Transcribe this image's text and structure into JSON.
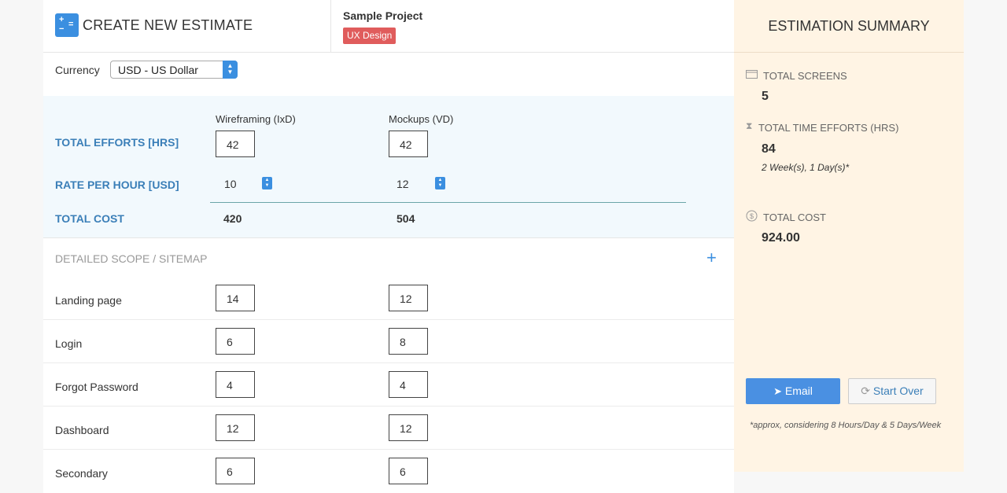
{
  "header": {
    "title": "CREATE NEW ESTIMATE",
    "project_name": "Sample Project",
    "project_tag": "UX Design"
  },
  "currency": {
    "label": "Currency",
    "selected": "USD - US Dollar"
  },
  "efforts": {
    "columns": [
      "Wireframing (IxD)",
      "Mockups (VD)"
    ],
    "total_efforts_label": "TOTAL EFFORTS [HRS]",
    "total_efforts": [
      "42",
      "42"
    ],
    "rate_label": "RATE PER HOUR [USD]",
    "rates": [
      "10",
      "12"
    ],
    "total_cost_label": "TOTAL COST",
    "total_costs": [
      "420",
      "504"
    ]
  },
  "scope": {
    "title": "DETAILED SCOPE / SITEMAP",
    "rows": [
      {
        "name": "Landing page",
        "wireframing": "14",
        "mockups": "12"
      },
      {
        "name": "Login",
        "wireframing": "6",
        "mockups": "8"
      },
      {
        "name": "Forgot Password",
        "wireframing": "4",
        "mockups": "4"
      },
      {
        "name": "Dashboard",
        "wireframing": "12",
        "mockups": "12"
      },
      {
        "name": "Secondary",
        "wireframing": "6",
        "mockups": "6"
      }
    ]
  },
  "summary": {
    "title": "ESTIMATION SUMMARY",
    "total_screens_label": "TOTAL SCREENS",
    "total_screens": "5",
    "total_time_label": "TOTAL TIME EFFORTS (HRS)",
    "total_time": "84",
    "time_note": "2 Week(s), 1 Day(s)*",
    "total_cost_label": "TOTAL COST",
    "total_cost": "924.00",
    "email_button": "Email",
    "start_over_button": "Start Over",
    "footnote": "*approx, considering 8 Hours/Day & 5 Days/Week"
  },
  "colors": {
    "accent": "#3b8fe0",
    "tag": "#e05c5c",
    "summary_bg": "#fff4e4",
    "effort_bg": "#f2f9fd"
  }
}
